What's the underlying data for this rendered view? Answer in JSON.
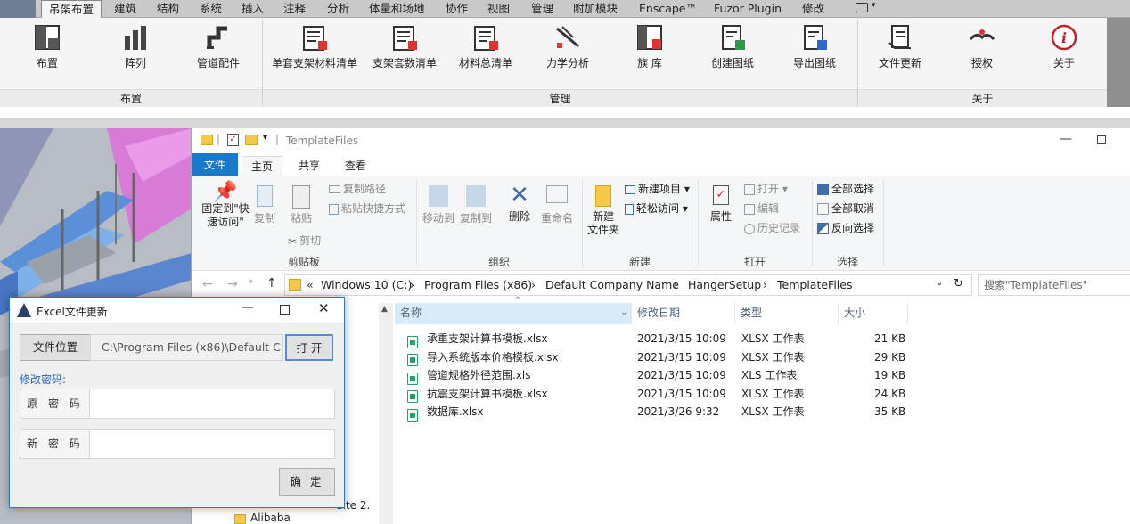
{
  "menubar": {
    "tabs": [
      "吊架布置",
      "建筑",
      "结构",
      "系统",
      "插入",
      "注释",
      "分析",
      "体量和场地",
      "协作",
      "视图",
      "管理",
      "附加模块",
      "Enscape™",
      "Fuzor Plugin",
      "修改"
    ],
    "active": "吊架布置"
  },
  "ribbon": {
    "buttons": {
      "layout": "布置",
      "array": "阵列",
      "pipe_fittings": "管道配件",
      "single_bom": "单套支架材料清单",
      "hanger_count": "支架套数清单",
      "material_total": "材料总清单",
      "mechanics": "力学分析",
      "family_lib": "族 库",
      "create_drawing": "创建图纸",
      "export_drawing": "导出图纸",
      "file_update": "文件更新",
      "authorize": "授权",
      "about": "关于"
    },
    "groups": {
      "layout": "布置",
      "manage": "管理",
      "about": "关于"
    }
  },
  "explorer": {
    "title": "TemplateFiles",
    "tabs": {
      "file": "文件",
      "home": "主页",
      "share": "共享",
      "view": "查看"
    },
    "clipboard": {
      "pin": "固定到\"快速访问\"",
      "copy": "复制",
      "paste": "粘贴",
      "copy_path": "复制路径",
      "paste_shortcut": "粘贴快捷方式",
      "cut": "剪切",
      "label": "剪贴板"
    },
    "organize": {
      "move_to": "移动到",
      "copy_to": "复制到",
      "delete": "删除",
      "rename": "重命名",
      "label": "组织"
    },
    "new": {
      "new_item": "新建项目",
      "easy_access": "轻松访问",
      "new_folder": "新建\n文件夹",
      "label": "新建"
    },
    "open": {
      "properties": "属性",
      "open": "打开",
      "edit": "编辑",
      "history": "历史记录",
      "label": "打开"
    },
    "select": {
      "select_all": "全部选择",
      "select_none": "全部取消",
      "invert": "反向选择",
      "label": "选择"
    },
    "breadcrumb": [
      "Windows 10 (C:)",
      "Program Files (x86)",
      "Default Company Name",
      "HangerSetup",
      "TemplateFiles"
    ],
    "search_placeholder": "搜索\"TemplateFiles\"",
    "columns": {
      "name": "名称",
      "modified": "修改日期",
      "type": "类型",
      "size": "大小"
    },
    "files": [
      {
        "name": "承重支架计算书模板.xlsx",
        "modified": "2021/3/15 10:09",
        "type": "XLSX 工作表",
        "size": "21 KB"
      },
      {
        "name": "导入系统版本价格模板.xlsx",
        "modified": "2021/3/15 10:09",
        "type": "XLSX 工作表",
        "size": "29 KB"
      },
      {
        "name": "管道规格外径范围.xls",
        "modified": "2021/3/15 10:09",
        "type": "XLS 工作表",
        "size": "19 KB"
      },
      {
        "name": "抗震支架计算书模板.xlsx",
        "modified": "2021/3/15 10:09",
        "type": "XLSX 工作表",
        "size": "24 KB"
      },
      {
        "name": "数据库.xlsx",
        "modified": "2021/3/26 9:32",
        "type": "XLSX 工作表",
        "size": "35 KB"
      }
    ],
    "nav_items": {
      "suite": "uite 2.",
      "alibaba": "Alibaba"
    }
  },
  "dialog": {
    "title": "Excel文件更新",
    "file_location_label": "文件位置",
    "file_path": "C:\\Program Files (x86)\\Default C",
    "open_button": "打 开",
    "change_password": "修改密码:",
    "old_password_label": "原 密 码",
    "new_password_label": "新 密 码",
    "confirm_button": "确 定"
  },
  "colors": {
    "accent": "#1979ca",
    "ribbon_bg": "#f5f5f5",
    "excel_green": "#21a366",
    "pipe_magenta": "#d44ad4",
    "pipe_blue": "#5b8fd8"
  }
}
